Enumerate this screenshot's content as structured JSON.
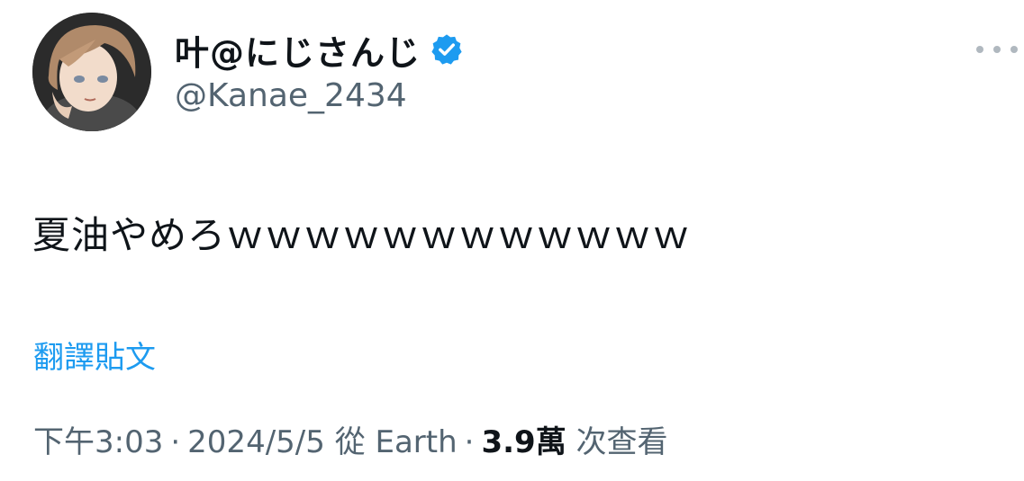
{
  "author": {
    "display_name": "叶@にじさんじ",
    "handle": "@Kanae_2434",
    "verified": true,
    "avatar_icon": "avatar-image",
    "verified_icon": "verified-badge-icon",
    "verified_color": "#1d9bf0"
  },
  "menu": {
    "icon": "more-options-icon"
  },
  "tweet": {
    "text": "夏油やめろｗｗｗｗｗｗｗｗｗｗｗｗ"
  },
  "translate_link": {
    "label": "翻譯貼文",
    "color": "#1d9bf0"
  },
  "meta": {
    "time": "下午3:03",
    "date": "2024/5/5",
    "source": "從 Earth",
    "views_count": "3.9萬",
    "views_label": "次查看",
    "separator": "·"
  }
}
